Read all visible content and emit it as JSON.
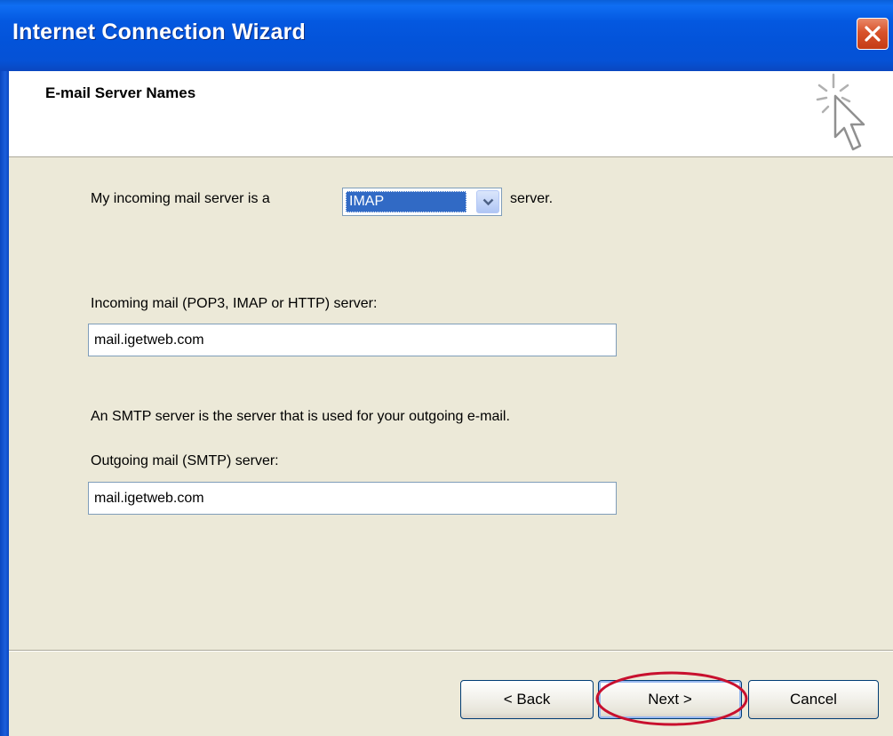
{
  "window": {
    "title": "Internet Connection Wizard"
  },
  "header": {
    "title": "E-mail Server Names",
    "icon": "wizard-cursor-icon"
  },
  "server_type": {
    "prefix_label": "My incoming mail server is a",
    "selected": "IMAP",
    "suffix_label": "server."
  },
  "incoming": {
    "label": "Incoming mail (POP3, IMAP or HTTP) server:",
    "value": "mail.igetweb.com"
  },
  "smtp_note": "An SMTP server is the server that is used for your outgoing e-mail.",
  "outgoing": {
    "label": "Outgoing mail (SMTP) server:",
    "value": "mail.igetweb.com"
  },
  "buttons": {
    "back": "< Back",
    "next": "Next >",
    "cancel": "Cancel"
  },
  "colors": {
    "titlebar": "#0458e0",
    "dialog_bg": "#ece9d8",
    "selection": "#316ac5",
    "highlight_ellipse": "#c8102e"
  }
}
